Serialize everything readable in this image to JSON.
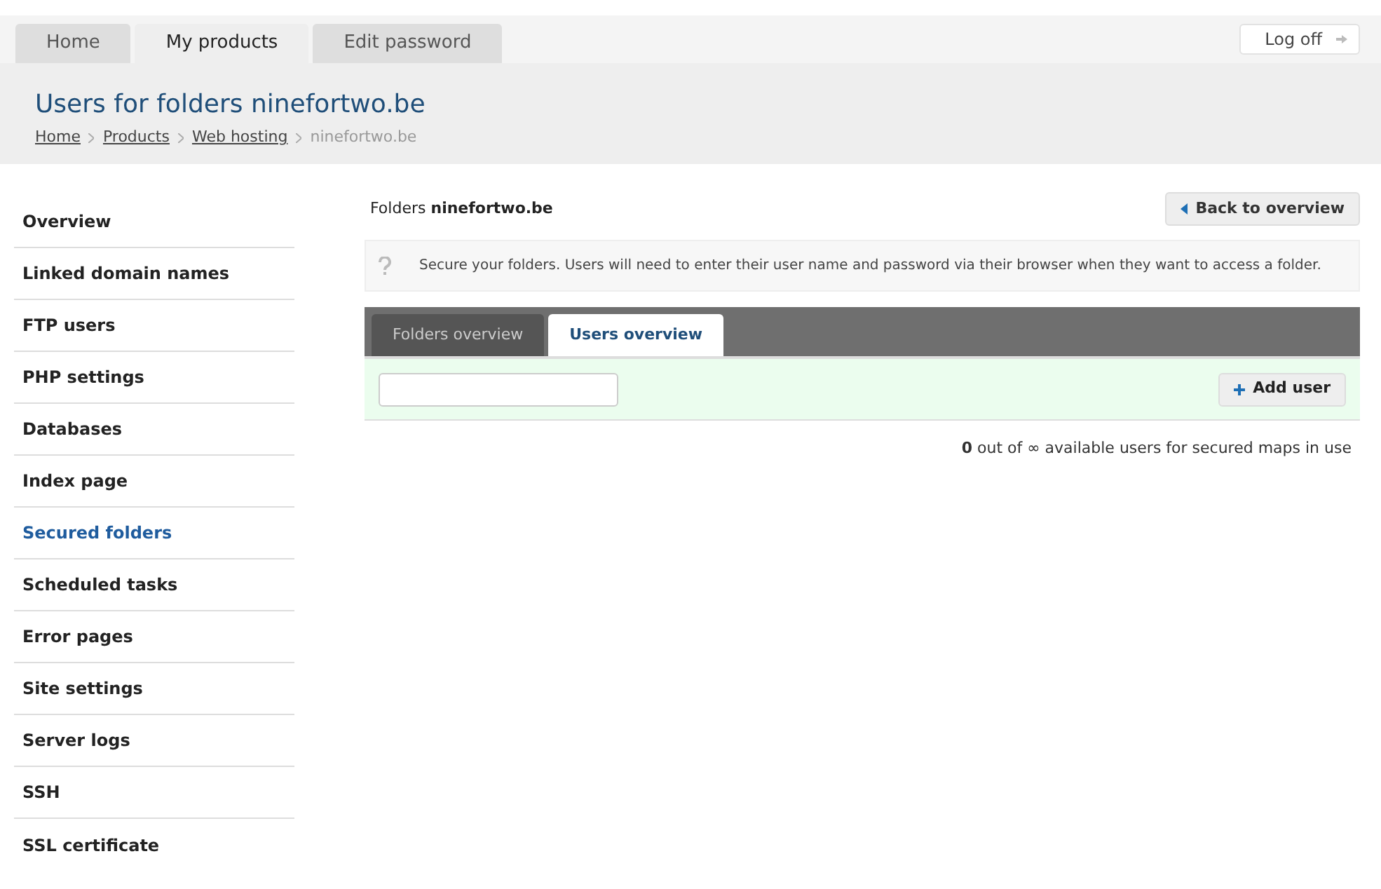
{
  "top_tabs": [
    {
      "label": "Home",
      "selected": false
    },
    {
      "label": "My products",
      "selected": true
    },
    {
      "label": "Edit password",
      "selected": false
    }
  ],
  "logoff": {
    "label": "Log off"
  },
  "header": {
    "title": "Users for folders ninefortwo.be",
    "breadcrumb": [
      "Home",
      "Products",
      "Web hosting"
    ],
    "breadcrumb_current": "ninefortwo.be"
  },
  "sidebar": {
    "items": [
      {
        "label": "Overview",
        "selected": false
      },
      {
        "label": "Linked domain names",
        "selected": false
      },
      {
        "label": "FTP users",
        "selected": false
      },
      {
        "label": "PHP settings",
        "selected": false
      },
      {
        "label": "Databases",
        "selected": false
      },
      {
        "label": "Index page",
        "selected": false
      },
      {
        "label": "Secured folders",
        "selected": true
      },
      {
        "label": "Scheduled tasks",
        "selected": false
      },
      {
        "label": "Error pages",
        "selected": false
      },
      {
        "label": "Site settings",
        "selected": false
      },
      {
        "label": "Server logs",
        "selected": false
      },
      {
        "label": "SSH",
        "selected": false
      },
      {
        "label": "SSL certificate",
        "selected": false
      }
    ]
  },
  "main": {
    "heading": "Folders **ninefortwo.be**",
    "back_button": "Back to overview",
    "info": "Secure your folders. Users will need to enter their user name and password via their browser when they want to access a folder.",
    "tabs": [
      {
        "label": "Folders overview",
        "selected": false
      },
      {
        "label": "Users overview",
        "selected": true
      }
    ],
    "add_button": "Add user",
    "usage": "**0** out of ∞ available users for secured maps in use"
  }
}
